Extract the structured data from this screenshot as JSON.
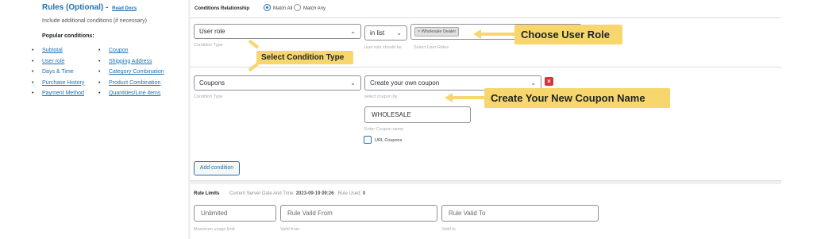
{
  "left_panel": {
    "title": "Rules (Optional)",
    "title_dash": "-",
    "read_docs": "Read Docs",
    "include_text": "Include additional conditions (if necessary)",
    "popular_label": "Popular conditions:",
    "col1": [
      "Subtotal",
      "User role",
      "Days & Time",
      "Purchase History",
      "Payment Method"
    ],
    "col1_linked": [
      true,
      true,
      false,
      true,
      true
    ],
    "col2": [
      "Coupon",
      "Shipping Address",
      "Category Combination",
      "Product Combination",
      "Quantities/Line items"
    ]
  },
  "conditions": {
    "relationship_label": "Conditions Relationship",
    "match_all": "Match All",
    "match_any": "Match Any",
    "row1": {
      "type_value": "User role",
      "type_hint": "Condition Type",
      "operator_value": "in list",
      "operator_hint": "user role should be",
      "roles_tag": "× Wholesale Dealer",
      "roles_hint": "Select User Roles"
    },
    "row2": {
      "type_value": "Coupons",
      "type_hint": "Condition Type",
      "coupon_select": "Create your own coupon",
      "coupon_hint": "select coupon by",
      "coupon_name": "WHOLESALE",
      "coupon_name_hint": "Enter Coupon name",
      "url_coupons": "URL Coupons",
      "remove": "×"
    },
    "add_condition": "Add condition"
  },
  "rule_limits": {
    "label": "Rule Limits",
    "server_date_label": "Current Server Date And Time:",
    "server_date": "2023-09-19 09:26",
    "rule_used_label": "Rule Used:",
    "rule_used": "0",
    "max_usage_placeholder": "Unlimited",
    "max_usage_hint": "Maximum usage limit",
    "valid_from_placeholder": "Rule Vaild From",
    "valid_from_hint": "Vaild from",
    "valid_to_placeholder": "Rule Valid To",
    "valid_to_hint": "Vaild to"
  },
  "callouts": {
    "choose_user_role": "Choose User Role",
    "select_condition_type": "Select Condition Type",
    "create_coupon_name": "Create Your New Coupon Name"
  },
  "colors": {
    "callout": "#f7d66e",
    "link": "#2271b1",
    "remove": "#d63638"
  }
}
